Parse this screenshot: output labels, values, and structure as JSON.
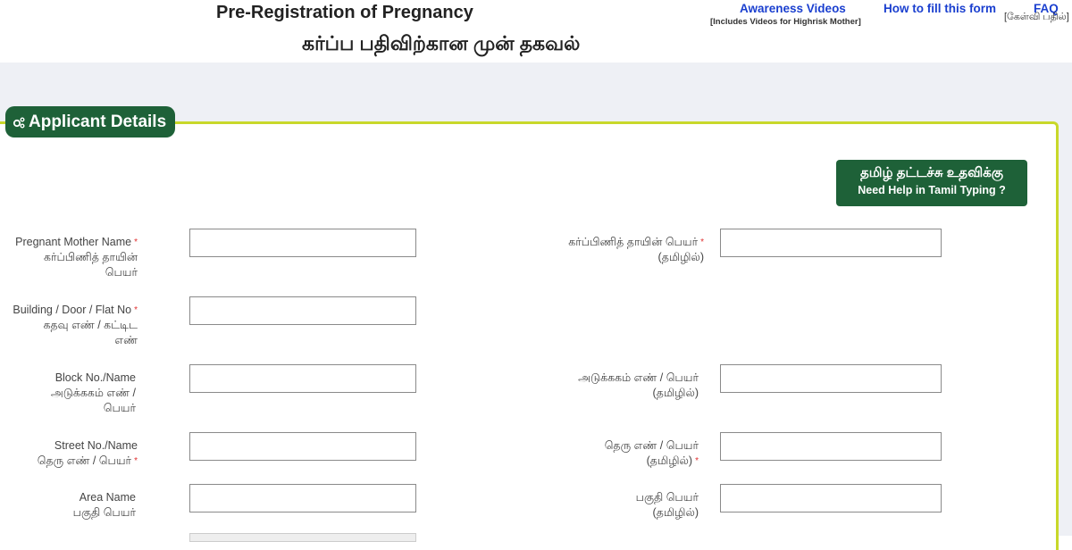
{
  "header": {
    "title_en": "Pre-Registration of Pregnancy",
    "title_ta": "கர்ப்ப பதிவிற்கான முன் தகவல்",
    "links": {
      "awareness": {
        "label": "Awareness Videos",
        "sub": "[Includes Videos for Highrisk Mother]"
      },
      "how_to": {
        "label": "How to fill this form"
      },
      "faq": {
        "label": "FAQ",
        "sub": "[கேள்வி பதில்]"
      }
    }
  },
  "section": {
    "title": "Applicant Details",
    "icon": "gears-icon"
  },
  "help_button": {
    "line1": "தமிழ் தட்டச்சு உதவிக்கு",
    "line2": "Need Help in Tamil Typing ?"
  },
  "colors": {
    "primary_green": "#1e6138",
    "accent_lime": "#c8d82a",
    "link_blue": "#1a3fcf",
    "required_red": "#e03030"
  },
  "form": {
    "left": [
      {
        "line1": "Pregnant Mother Name",
        "line2": "கர்ப்பிணித் தாயின்",
        "line3": "பெயர்",
        "required": "*",
        "value": ""
      },
      {
        "line1": "Building / Door / Flat No",
        "line2": "கதவு எண் / கட்டிட",
        "line3": "எண்",
        "required": "*",
        "value": ""
      },
      {
        "line1": "Block No./Name",
        "line2": "அடுக்ககம் எண் /",
        "line3": "பெயர்",
        "value": ""
      },
      {
        "line1": "Street No./Name",
        "line2": "தெரு எண் / பெயர்",
        "required": "*",
        "value": ""
      },
      {
        "line1": "Area Name",
        "line2": "பகுதி பெயர்",
        "value": ""
      }
    ],
    "right": [
      {
        "line1": "கர்ப்பிணித் தாயின் பெயர்",
        "line2": "(தமிழில்)",
        "required": "*",
        "value": ""
      },
      {
        "line1": "அடுக்ககம் எண் / பெயர்",
        "line2": "(தமிழில்)",
        "value": ""
      },
      {
        "line1": "தெரு எண் / பெயர்",
        "line2": "(தமிழில்)",
        "required": "*",
        "value": ""
      },
      {
        "line1": "பகுதி பெயர்",
        "line2": "(தமிழில்)",
        "value": ""
      }
    ]
  }
}
